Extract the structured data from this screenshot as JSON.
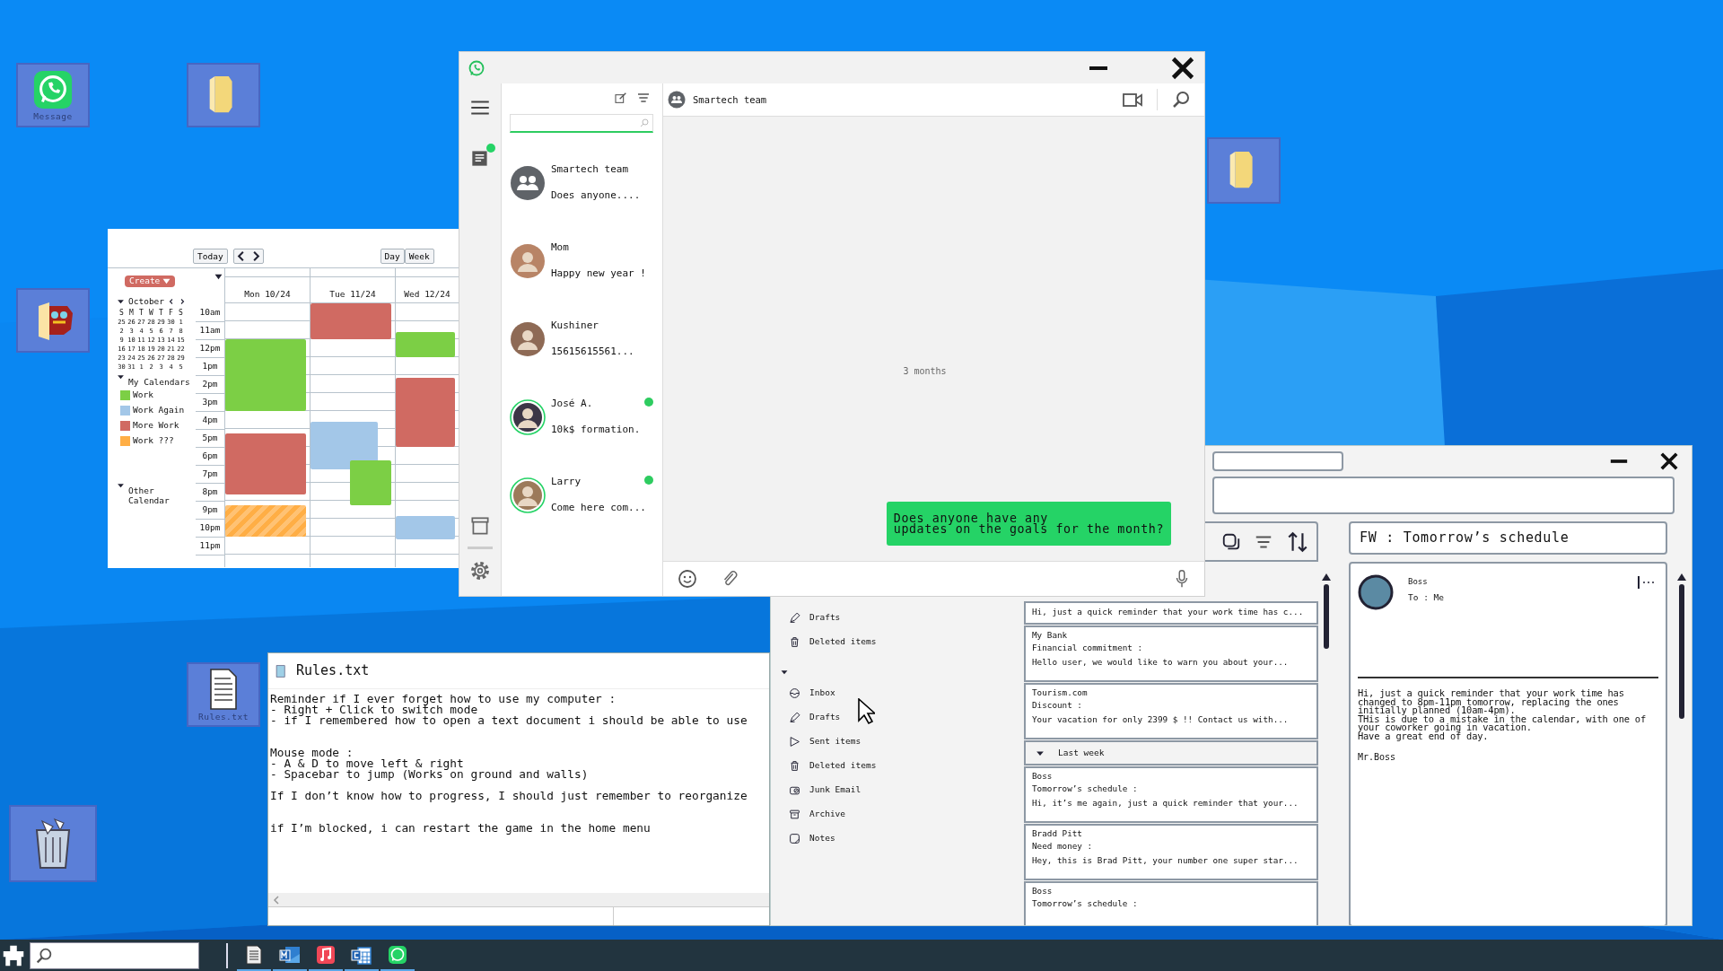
{
  "desktop_icons": [
    {
      "kind": "chat",
      "label": "Message"
    },
    {
      "kind": "folder"
    },
    {
      "kind": "folder"
    },
    {
      "kind": "creature-folder"
    },
    {
      "kind": "text-file",
      "label": "Rules.txt"
    },
    {
      "kind": "bin"
    }
  ],
  "calendar": {
    "today": "Today",
    "views": [
      "Day",
      "Week"
    ],
    "create": "Create",
    "month": {
      "label": "October",
      "expanded": true
    },
    "weekdays": [
      "S",
      "M",
      "T",
      "W",
      "T",
      "F",
      "S"
    ],
    "weeks": [
      [
        "25",
        "26",
        "27",
        "28",
        "29",
        "30",
        "1"
      ],
      [
        "2",
        "3",
        "4",
        "5",
        "6",
        "7",
        "8"
      ],
      [
        "9",
        "10",
        "11",
        "12",
        "13",
        "14",
        "15"
      ],
      [
        "16",
        "17",
        "18",
        "19",
        "20",
        "21",
        "22"
      ],
      [
        "23",
        "24",
        "25",
        "26",
        "27",
        "28",
        "29"
      ],
      [
        "30",
        "31",
        "1",
        "2",
        "3",
        "4",
        "5"
      ]
    ],
    "groups": [
      {
        "title": "My Calendars",
        "expanded": true,
        "items": [
          {
            "label": "Work",
            "color": "#7ccf45"
          },
          {
            "label": "Work Again",
            "color": "#a3c7e8"
          },
          {
            "label": "More Work",
            "color": "#d06a62"
          },
          {
            "label": "Work ???",
            "color": "#ffae45"
          }
        ]
      },
      {
        "title": "Other Calendar",
        "expanded": true
      }
    ],
    "hours": [
      "10am",
      "11am",
      "12pm",
      "1pm",
      "2pm",
      "3pm",
      "4pm",
      "5pm",
      "6pm",
      "7pm",
      "8pm",
      "9pm",
      "10pm",
      "11pm"
    ],
    "days": [
      {
        "label": "Mon 10/24",
        "events": [
          {
            "color": "#7ccf45",
            "striped": false
          },
          {
            "color": "#d06a62",
            "striped": false
          },
          {
            "color": "#ffae45",
            "striped": true
          }
        ]
      },
      {
        "label": "Tue 11/24",
        "events": [
          {
            "color": "#d06a62",
            "striped": false
          },
          {
            "color": "#a3c7e8",
            "striped": false
          },
          {
            "color": "#7ccf45",
            "striped": false
          }
        ]
      },
      {
        "label": "Wed 12/24",
        "events": [
          {
            "color": "#7ccf45",
            "striped": false
          },
          {
            "color": "#d06a62",
            "striped": false
          },
          {
            "color": "#a3c7e8",
            "striped": false
          }
        ]
      }
    ]
  },
  "notepad": {
    "title": "Rules.txt",
    "text": "Reminder if I ever forget how to use my computer :\n- Right + Click to switch mode\n- if I remembered how to open a text document i should be able to use\n\n\nMouse mode :\n- A & D to move left & right\n- Spacebar to jump (Works on ground and walls)\n\nIf I don’t know how to progress, I should just remember to reorganize\n\n\nif I’m blocked, i can restart the game in the home menu"
  },
  "mail": {
    "folders": [
      {
        "label": "Drafts",
        "kind": "drafts"
      },
      {
        "label": "Deleted items",
        "kind": "trash"
      }
    ],
    "account": {
      "expanded": true,
      "folders": [
        {
          "label": "Inbox",
          "kind": "inbox"
        },
        {
          "label": "Drafts",
          "kind": "drafts"
        },
        {
          "label": "Sent items",
          "kind": "sent"
        },
        {
          "label": "Deleted items",
          "kind": "trash"
        },
        {
          "label": "Junk Email",
          "kind": "junk"
        },
        {
          "label": "Archive",
          "kind": "archive"
        },
        {
          "label": "Notes",
          "kind": "notes"
        }
      ]
    },
    "message_groups": [
      {
        "messages": [
          {
            "preview": "Hi, just a quick reminder that your work time has c..."
          },
          {
            "sender": "My Bank",
            "subject": "Financial commitment :",
            "preview": "Hello user, we would like to warn you about your..."
          },
          {
            "sender": "Tourism.com",
            "subject": "Discount :",
            "preview": "Your vacation for only 2399 $ !! Contact us with..."
          }
        ]
      },
      {
        "title": "Last week",
        "expanded": true,
        "messages": [
          {
            "sender": "Boss",
            "subject": "Tomorrow’s schedule :",
            "preview": "Hi, it’s me again, just a quick reminder that your..."
          },
          {
            "sender": "Bradd Pitt",
            "subject": "Need money :",
            "preview": "Hey, this is Brad Pitt, your number one super star..."
          },
          {
            "sender": "Boss",
            "subject": "Tomorrow’s schedule :"
          }
        ]
      }
    ],
    "reading": {
      "subject": "FW : Tomorrow’s schedule",
      "sender": "Boss",
      "to": "To : Me",
      "body": "Hi, just a quick reminder that your work time has\nchanged to 8pm-11pm tomorrow, replacing the ones\ninitially planned (10am-4pm).\nTHis is due to a mistake in the calendar, with one of\nyour coworker going in vacation.\nHave a great end of day.",
      "signature": "Mr.Boss"
    }
  },
  "chat": {
    "unread_chats": true,
    "contacts": [
      {
        "name": "Smartech team",
        "preview": "Does anyone....",
        "kind": "group",
        "online": false
      },
      {
        "name": "Mom",
        "preview": "Happy new year !",
        "kind": "person",
        "online": false
      },
      {
        "name": "Kushiner",
        "preview": "15615615561...",
        "kind": "person",
        "online": false
      },
      {
        "name": "José A.",
        "preview": "10k$ formation.",
        "kind": "person",
        "online": true
      },
      {
        "name": "Larry",
        "preview": "Come here com...",
        "kind": "person",
        "online": true
      }
    ],
    "conversation": {
      "name": "Smartech team",
      "divider": "3 months",
      "messages": [
        {
          "text": "Does anyone have any\nupdates on the goals for the month?",
          "outgoing": true
        }
      ]
    }
  },
  "taskbar": {
    "apps": [
      {
        "kind": "notepad",
        "running": true
      },
      {
        "kind": "mail",
        "running": true
      },
      {
        "kind": "music",
        "running": true
      },
      {
        "kind": "calendar",
        "running": true
      },
      {
        "kind": "chat",
        "running": true
      }
    ]
  }
}
